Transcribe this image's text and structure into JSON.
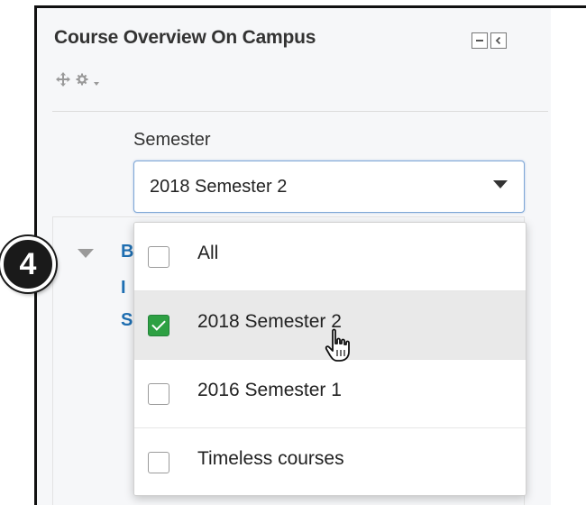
{
  "block": {
    "title": "Course Overview On Campus",
    "controls": [
      {
        "icon": "collapse-block-icon"
      },
      {
        "icon": "dock-block-icon"
      }
    ],
    "tools": [
      {
        "icon": "move-icon"
      },
      {
        "icon": "gear-icon"
      },
      {
        "icon": "caret-down-icon"
      }
    ]
  },
  "filter": {
    "label": "Semester",
    "selected_value": "2018 Semester 2",
    "options": [
      {
        "label": "All",
        "checked": false,
        "highlighted": false
      },
      {
        "label": "2018 Semester 2",
        "checked": true,
        "highlighted": true
      },
      {
        "label": "2016 Semester 1",
        "checked": false,
        "highlighted": false
      },
      {
        "label": "Timeless courses",
        "checked": false,
        "highlighted": false
      }
    ]
  },
  "callout": {
    "number": "4"
  },
  "course_peek": {
    "line1": "B",
    "line2": "I",
    "line3": "S"
  },
  "colors": {
    "block_bg": "#f6f7f9",
    "check_green": "#2ea043",
    "link_blue": "#1f6fb2",
    "focus_blue": "#7fa7d6",
    "hover_row": "#e9e9e9"
  }
}
